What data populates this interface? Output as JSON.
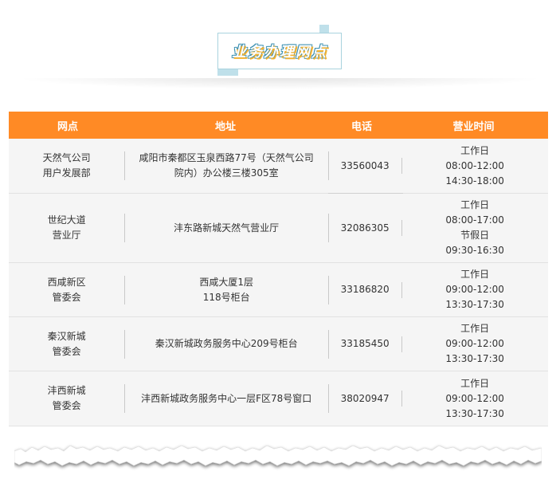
{
  "section_title": "业务办理网点",
  "table": {
    "headers": [
      "网点",
      "地址",
      "电话",
      "营业时间"
    ],
    "rows": [
      {
        "outlet": [
          "天然气公司",
          "用户发展部"
        ],
        "address": [
          "咸阳市秦都区玉泉西路77号（天然气公司",
          "院内）办公楼三楼305室"
        ],
        "phone": "33560043",
        "hours": [
          "工作日",
          "08:00-12:00",
          "14:30-18:00"
        ]
      },
      {
        "outlet": [
          "世纪大道",
          "营业厅"
        ],
        "address": [
          "沣东路新城天然气营业厅"
        ],
        "phone": "32086305",
        "hours": [
          "工作日",
          "08:00-17:00",
          "节假日",
          "09:30-16:30"
        ]
      },
      {
        "outlet": [
          "西咸新区",
          "管委会"
        ],
        "address": [
          "西咸大厦1层",
          "118号柜台"
        ],
        "phone": "33186820",
        "hours": [
          "工作日",
          "09:00-12:00",
          "13:30-17:30"
        ]
      },
      {
        "outlet": [
          "秦汉新城",
          "管委会"
        ],
        "address": [
          "秦汉新城政务服务中心209号柜台"
        ],
        "phone": "33185450",
        "hours": [
          "工作日",
          "09:00-12:00",
          "13:30-17:30"
        ]
      },
      {
        "outlet": [
          "沣西新城",
          "管委会"
        ],
        "address": [
          "沣西新城政务服务中心一层F区78号窗口"
        ],
        "phone": "38020947",
        "hours": [
          "工作日",
          "09:00-12:00",
          "13:30-17:30"
        ]
      }
    ]
  },
  "colors": {
    "header_bg": "#ff8a25",
    "row_bg": "#f5f5f5",
    "title_border": "#a9d3de",
    "title_accent": "#f2b233"
  }
}
